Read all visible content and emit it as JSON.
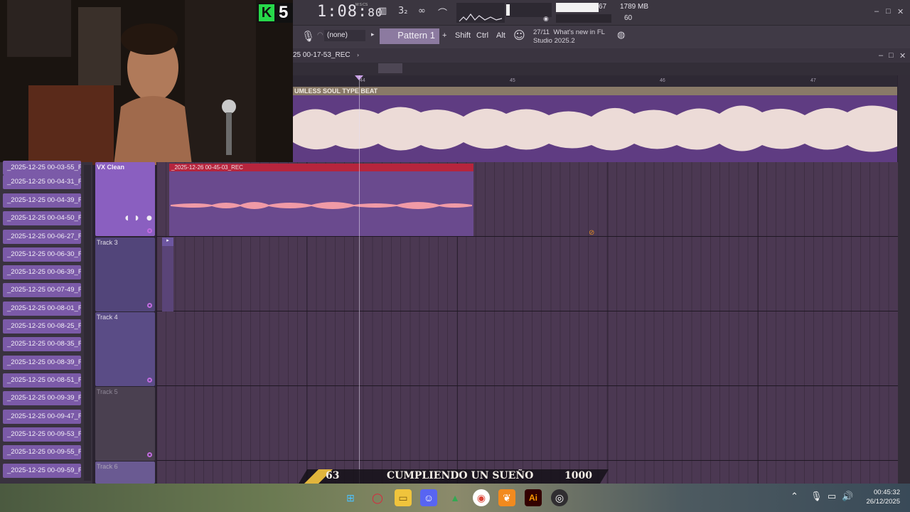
{
  "topbar": {
    "badge_letter": "K",
    "badge_number": "5",
    "time_main": "1:08:",
    "time_frac": "80",
    "time_unit": "M:S:CS",
    "tempo_glyph": "3₂",
    "cpu": "67",
    "memory": "1789 MB",
    "polyphony": "60",
    "minimize": "–",
    "restore": "□",
    "close": "✕"
  },
  "toolbar2": {
    "pattern_selector": "(none)",
    "pattern_label": "Pattern 1",
    "add_label": "+",
    "shift": "Shift",
    "ctrl": "Ctrl",
    "alt": "Alt",
    "news_date": "27/11",
    "news_text_1": "What's new in FL",
    "news_text_2": "Studio 2025.2"
  },
  "playlist": {
    "title": "25 00-17-53_REC",
    "ruler": [
      "44",
      "45",
      "46",
      "47"
    ],
    "beat_clip_name": "UMLESS SOUL TYPE BEAT",
    "vx_track_name": "VX Clean",
    "vx_clip_name": "_2025-12-26 00-45-03_REC",
    "tracks": [
      "Track 3",
      "Track 4",
      "Track 5",
      "Track 6"
    ]
  },
  "browser": {
    "items": [
      "_2025-12-25 00-03-55_R...",
      "_2025-12-25 00-04-31_R...",
      "_2025-12-25 00-04-39_R...",
      "_2025-12-25 00-04-50_R...",
      "_2025-12-25 00-06-27_R...",
      "_2025-12-25 00-06-30_R...",
      "_2025-12-25 00-06-39_R...",
      "_2025-12-25 00-07-49_R...",
      "_2025-12-25 00-08-01_R...",
      "_2025-12-25 00-08-25_R...",
      "_2025-12-25 00-08-35_R...",
      "_2025-12-25 00-08-39_R...",
      "_2025-12-25 00-08-51_R...",
      "_2025-12-25 00-09-39_R...",
      "_2025-12-25 00-09-47_R...",
      "_2025-12-25 00-09-53_R...",
      "_2025-12-25 00-09-55_R...",
      "_2025-12-25 00-09-59_R..."
    ]
  },
  "overlay": {
    "left_number": "63",
    "title": "CUMPLIENDO UN SUEÑO",
    "right_number": "1000"
  },
  "taskbar": {
    "time": "00:45:32",
    "date": "26/12/2025",
    "apps": [
      "windows-start",
      "opera",
      "file-explorer",
      "discord",
      "google-drive",
      "chrome",
      "fl-studio",
      "illustrator",
      "obs"
    ]
  },
  "colors": {
    "accent_purple": "#7b5aa8",
    "clip_red": "#b6253d",
    "badge_green": "#27d84a",
    "overlay_gold": "#e1b53c"
  }
}
